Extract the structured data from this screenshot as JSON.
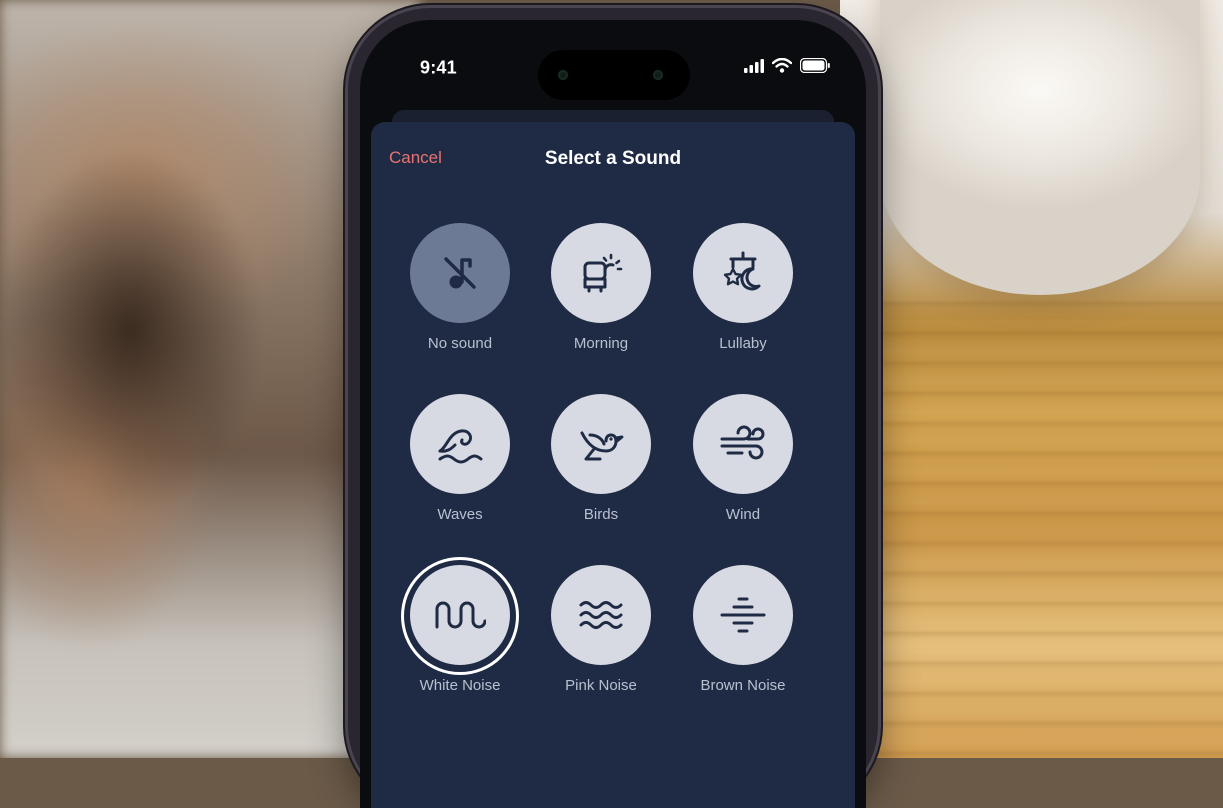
{
  "status_bar": {
    "time": "9:41"
  },
  "sheet": {
    "cancel_label": "Cancel",
    "title": "Select a Sound"
  },
  "sounds": [
    {
      "label": "No sound",
      "icon": "music-note-slash-icon",
      "state": "muted"
    },
    {
      "label": "Morning",
      "icon": "sunrise-window-icon"
    },
    {
      "label": "Lullaby",
      "icon": "moon-mobile-icon"
    },
    {
      "label": "Waves",
      "icon": "wave-icon"
    },
    {
      "label": "Birds",
      "icon": "bird-icon"
    },
    {
      "label": "Wind",
      "icon": "wind-icon"
    },
    {
      "label": "White Noise",
      "icon": "square-wave-icon",
      "selected": true
    },
    {
      "label": "Pink Noise",
      "icon": "triple-wave-icon"
    },
    {
      "label": "Brown Noise",
      "icon": "divide-lines-icon"
    }
  ],
  "colors": {
    "sheet_background": "#1f2b45",
    "cancel_text": "#e8736e",
    "sound_circle": "#d7dae2",
    "muted_circle": "#6d7a95",
    "icon_stroke": "#1f2b45",
    "label_text": "#b9c0cf"
  }
}
